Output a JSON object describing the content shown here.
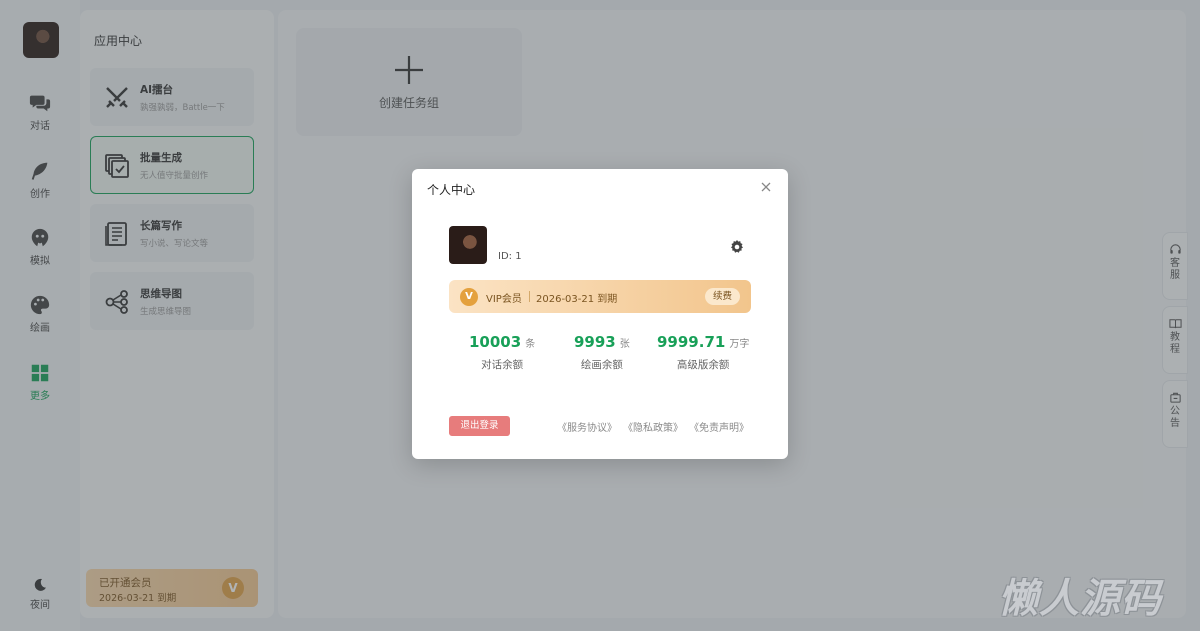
{
  "rail": {
    "items": [
      {
        "label": "对话",
        "icon": "chat-icon"
      },
      {
        "label": "创作",
        "icon": "feather-icon"
      },
      {
        "label": "模拟",
        "icon": "mask-icon"
      },
      {
        "label": "绘画",
        "icon": "palette-icon"
      },
      {
        "label": "更多",
        "icon": "grid-icon",
        "active": true
      }
    ],
    "night_label": "夜间"
  },
  "apps": {
    "title": "应用中心",
    "cards": [
      {
        "title": "AI擂台",
        "desc": "孰强孰弱，Battle一下",
        "icon": "swords-icon"
      },
      {
        "title": "批量生成",
        "desc": "无人值守批量创作",
        "icon": "batch-icon",
        "selected": true
      },
      {
        "title": "长篇写作",
        "desc": "写小说、写论文等",
        "icon": "document-icon"
      },
      {
        "title": "思维导图",
        "desc": "生成思维导图",
        "icon": "mindmap-icon"
      }
    ],
    "member": {
      "title": "已开通会员",
      "expiry": "2026-03-21 到期",
      "badge": "V"
    }
  },
  "workspace": {
    "create_label": "创建任务组"
  },
  "side_tabs": [
    {
      "label": "客服",
      "icon": "headset-icon"
    },
    {
      "label": "教程",
      "icon": "book-icon"
    },
    {
      "label": "公告",
      "icon": "notice-icon"
    }
  ],
  "modal": {
    "title": "个人中心",
    "id_text": "ID: 1",
    "vip": {
      "badge": "V",
      "label": "VIP会员",
      "expiry": "2026-03-21 到期",
      "renew": "续费"
    },
    "stats": [
      {
        "value": "10003",
        "unit": "条",
        "caption": "对话余额"
      },
      {
        "value": "9993",
        "unit": "张",
        "caption": "绘画余额"
      },
      {
        "value": "9999.71",
        "unit": "万字",
        "caption": "高级版余额"
      }
    ],
    "logout": "退出登录",
    "links": [
      "《服务协议》",
      "《隐私政策》",
      "《免责声明》"
    ]
  },
  "watermark": "懒人源码",
  "colors": {
    "accent": "#18a058",
    "vip_gold": "#e4a13e",
    "logout": "#e77c7c"
  }
}
